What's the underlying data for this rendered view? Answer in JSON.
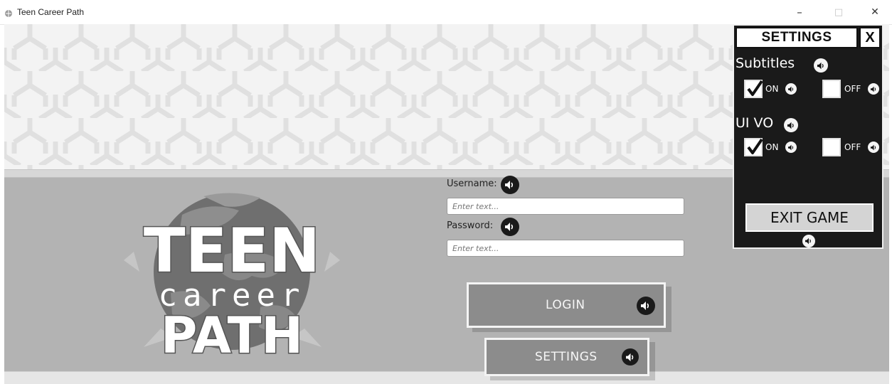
{
  "window": {
    "title": "Teen Career Path",
    "minimize_glyph": "–",
    "maximize_glyph": "□",
    "close_glyph": "✕"
  },
  "logo": {
    "line1": "TEEN",
    "line2": "career",
    "line3": "PATH"
  },
  "login_form": {
    "username_label": "Username:",
    "username_placeholder": "Enter text...",
    "username_value": "",
    "password_label": "Password:",
    "password_placeholder": "Enter text...",
    "password_value": ""
  },
  "buttons": {
    "login_label": "LOGIN",
    "settings_label": "SETTINGS"
  },
  "settings_panel": {
    "title": "SETTINGS",
    "close_label": "X",
    "subtitles": {
      "label": "Subtitles",
      "on_label": "ON",
      "off_label": "OFF",
      "on_checked": true,
      "off_checked": false
    },
    "ui_vo": {
      "label": "UI VO",
      "on_label": "ON",
      "off_label": "OFF",
      "on_checked": true,
      "off_checked": false
    },
    "exit_label": "EXIT GAME"
  },
  "icons": {
    "speaker": "speaker-icon",
    "checkmark": "checkmark-icon",
    "app": "app-icon"
  },
  "colors": {
    "panel_bg": "#1a1a1a",
    "button_bg": "#8c8c8c",
    "game_bg": "#b3b3b3"
  }
}
